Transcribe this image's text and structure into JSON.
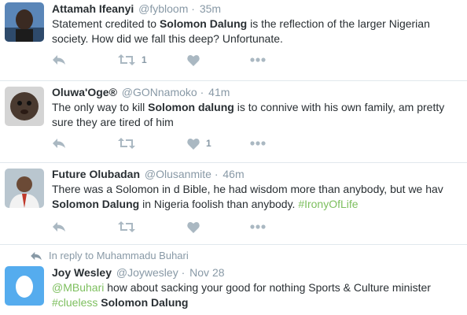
{
  "tweets": [
    {
      "fullname": "Attamah Ifeanyi",
      "username": "@fybloom",
      "time": "35m",
      "text_before": "Statement credited to ",
      "bold": "Solomon Dalung",
      "text_after": " is the reflection of the larger Nigerian society. How did we fall this deep? Unfortunate.",
      "retweets": "1",
      "likes": ""
    },
    {
      "fullname": "Oluwa'Oge®",
      "username": "@GONnamoko",
      "time": "41m",
      "text_before": "The only way to kill ",
      "bold": "Solomon dalung",
      "text_after": " is to connive with his own family, am pretty sure they are tired of him",
      "retweets": "",
      "likes": "1"
    },
    {
      "fullname": "Future Olubadan",
      "username": "@Olusanmite",
      "time": "46m",
      "text_before": "There was a Solomon in d Bible, he had wisdom more than anybody, but we hav ",
      "bold": "Solomon Dalung",
      "text_after": " in Nigeria foolish than anybody. ",
      "hashtag": "#IronyOfLife",
      "retweets": "",
      "likes": ""
    },
    {
      "reply_context": "In reply to Muhammadu Buhari",
      "fullname": "Joy Wesley",
      "username": "@Joywesley",
      "time": "Nov 28",
      "mention": "@MBuhari",
      "text_before": " how about sacking your good for nothing Sports & Culture minister ",
      "hashtag": "#clueless",
      "bold": "Solomon Dalung"
    }
  ],
  "separator": "·",
  "colors": {
    "link": "#7dbf5e",
    "meta": "#8899a6",
    "icon": "#aab8c2",
    "text": "#292f33"
  }
}
